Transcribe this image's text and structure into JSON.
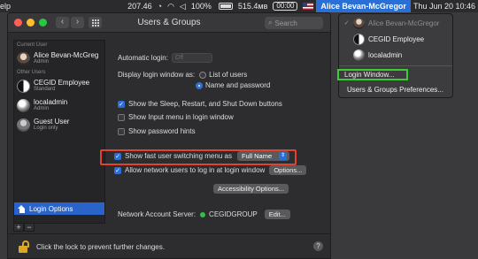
{
  "menubar": {
    "app_fragment": "elp",
    "stat_number": "207.46",
    "battery_percent": "100%",
    "net_speed": "515.4мв",
    "timer": "00:00",
    "user": "Alice Bevan-McGregor",
    "datetime": "Thu Jun 20  10:46"
  },
  "window": {
    "title": "Users & Groups",
    "search_placeholder": "Search"
  },
  "sidebar": {
    "current_user_heading": "Current User",
    "other_users_heading": "Other Users",
    "current_user": {
      "name": "Alice Bevan-McGreg",
      "role": "Admin"
    },
    "other_users": [
      {
        "name": "CEGID Employee",
        "role": "Standard"
      },
      {
        "name": "localadmin",
        "role": "Admin"
      },
      {
        "name": "Guest User",
        "role": "Login only"
      }
    ],
    "login_options_label": "Login Options",
    "add_label": "+",
    "remove_label": "−"
  },
  "pane": {
    "automatic_login_label": "Automatic login:",
    "automatic_login_value": "Off",
    "display_login_label": "Display login window as:",
    "radio_list_label": "List of users",
    "radio_name_label": "Name and password",
    "cb_sleep_label": "Show the Sleep, Restart, and Shut Down buttons",
    "cb_input_menu_label": "Show Input menu in login window",
    "cb_password_hints_label": "Show password hints",
    "cb_fast_switch_label": "Show fast user switching menu as",
    "fast_switch_value": "Full Name",
    "cb_network_users_label": "Allow network users to log in at login window",
    "options_button": "Options...",
    "accessibility_button": "Accessibility Options...",
    "network_server_label": "Network Account Server:",
    "network_server_value": "CEGIDGROUP",
    "edit_button": "Edit..."
  },
  "bottom": {
    "lock_text": "Click the lock to prevent further changes.",
    "help_label": "?"
  },
  "fus_menu": {
    "users": [
      {
        "name": "Alice Bevan-McGregor",
        "current": true
      },
      {
        "name": "CEGID Employee",
        "current": false
      },
      {
        "name": "localadmin",
        "current": false
      }
    ],
    "login_window_label": "Login Window...",
    "prefs_label": "Users & Groups Preferences..."
  },
  "colors": {
    "accent": "#2a63c9",
    "highlight_red": "#e0432f",
    "highlight_green": "#3dcc36",
    "lock": "#d9a825"
  }
}
